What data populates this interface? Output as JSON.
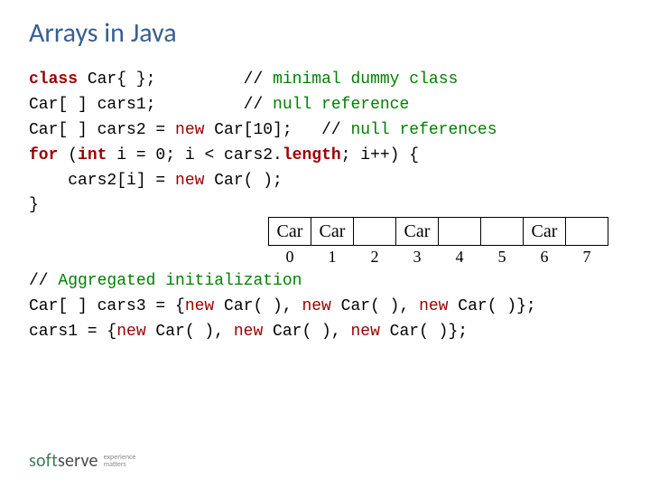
{
  "title": "Arrays in Java",
  "code": {
    "l1_kw": "class",
    "l1_a": " Car{ };         ",
    "l1_c": "// ",
    "l1_cm": "minimal dummy class",
    "l2_a": "Car[ ] cars1;         ",
    "l2_c": "// ",
    "l2_cm": "null reference",
    "l3_a": "Car[ ] cars2 = ",
    "l3_new": "new",
    "l3_b": " Car[10];   ",
    "l3_c": "// ",
    "l3_cm": "null references",
    "l4_for": "for",
    "l4_a": " (",
    "l4_int": "int",
    "l4_b": " i = 0; i < cars2.",
    "l4_len": "length",
    "l4_c": "; i++) {",
    "l5_a": "    cars2[i] = ",
    "l5_new": "new",
    "l5_b": " Car( );",
    "l6": "}",
    "blank": " ",
    "l7_c": "// ",
    "l7_cm": "Aggregated initialization",
    "l8_a": "Car[ ] cars3 = {",
    "l8_new1": "new",
    "l8_b": " Car( ), ",
    "l8_new2": "new",
    "l8_c": " Car( ), ",
    "l8_new3": "new",
    "l8_d": " Car( )};",
    "l9_a": "cars1 = {",
    "l9_new1": "new",
    "l9_b": " Car( ), ",
    "l9_new2": "new",
    "l9_c": " Car( ), ",
    "l9_new3": "new",
    "l9_d": " Car( )};"
  },
  "diagram": {
    "cells": [
      "Car",
      "Car",
      "",
      "Car",
      "",
      "",
      "Car",
      ""
    ],
    "indices": [
      "0",
      "1",
      "2",
      "3",
      "4",
      "5",
      "6",
      "7"
    ]
  },
  "logo": {
    "soft": "soft",
    "serve": "serve",
    "tag1": "experience",
    "tag2": "matters"
  }
}
